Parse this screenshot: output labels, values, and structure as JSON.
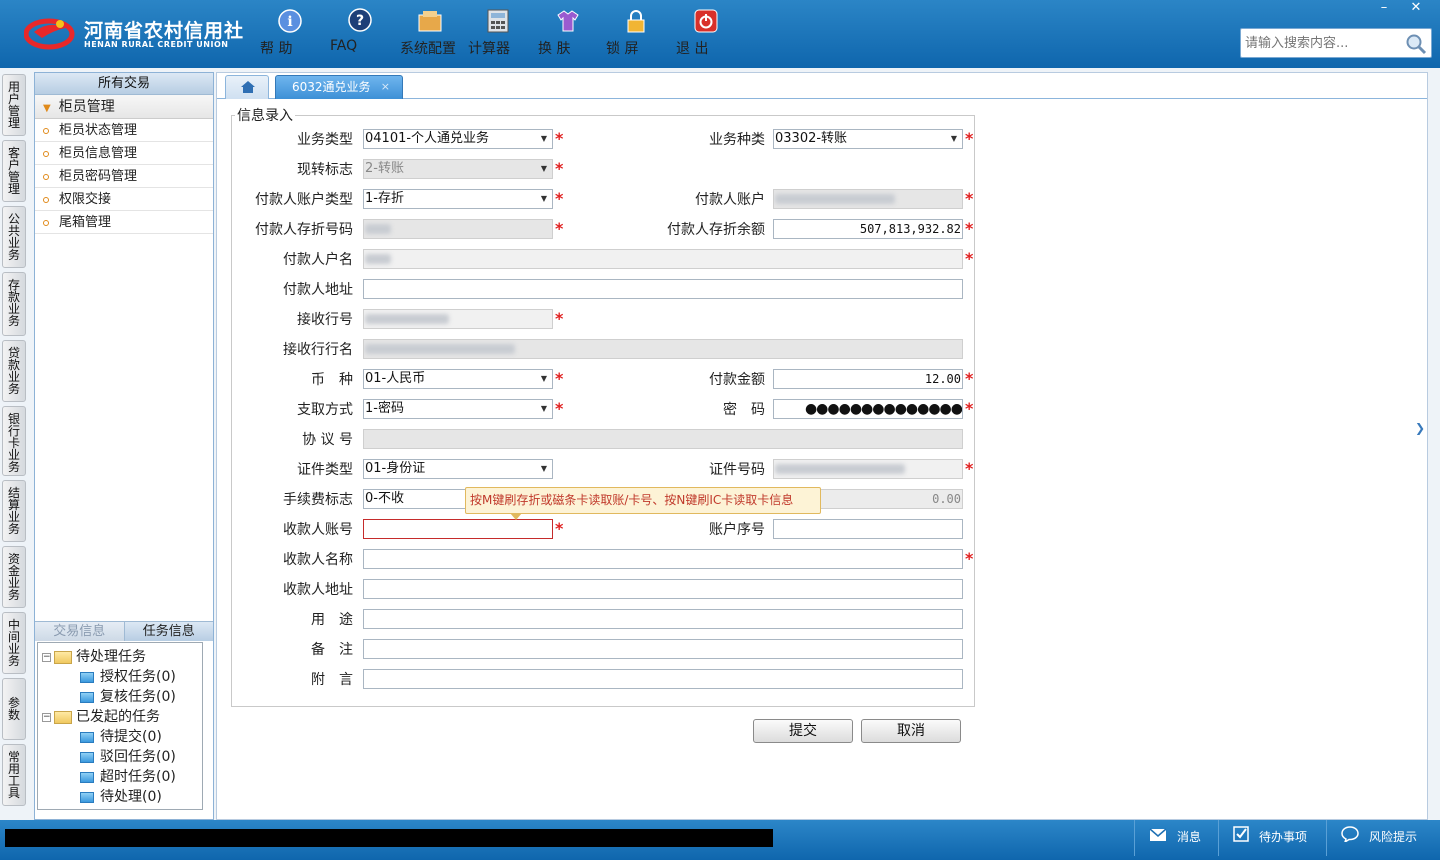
{
  "brand": {
    "cn": "河南省农村信用社",
    "en": "HENAN RURAL CREDIT UNION"
  },
  "toolbar": [
    {
      "label": "帮 助",
      "icon": "help-icon"
    },
    {
      "label": "FAQ",
      "icon": "faq-icon"
    },
    {
      "label": "系统配置",
      "icon": "settings-icon"
    },
    {
      "label": "计算器",
      "icon": "calculator-icon"
    },
    {
      "label": "换 肤",
      "icon": "skin-icon"
    },
    {
      "label": "锁 屏",
      "icon": "lock-icon"
    },
    {
      "label": "退 出",
      "icon": "power-icon"
    }
  ],
  "window": {
    "minimize": "–",
    "close": "✕"
  },
  "search": {
    "placeholder": "请输入搜索内容..."
  },
  "vtabs": [
    "用户管理",
    "客户管理",
    "公共业务",
    "存款业务",
    "贷款业务",
    "银行卡业务",
    "结算业务",
    "资金业务",
    "中间业务",
    "参数",
    "常用工具"
  ],
  "sidebar": {
    "header": "所有交易",
    "group": "柜员管理",
    "items": [
      "柜员状态管理",
      "柜员信息管理",
      "柜员密码管理",
      "权限交接",
      "尾箱管理"
    ]
  },
  "tasks": {
    "tabs": [
      "交易信息",
      "任务信息"
    ],
    "pending": {
      "label": "待处理任务",
      "children": [
        "授权任务(0)",
        "复核任务(0)"
      ]
    },
    "initiated": {
      "label": "已发起的任务",
      "children": [
        "待提交(0)",
        "驳回任务(0)",
        "超时任务(0)",
        "待处理(0)"
      ]
    }
  },
  "tab": {
    "title": "6032通兑业务",
    "close": "×"
  },
  "form": {
    "legend": "信息录入",
    "labels": {
      "biz_type": "业务类型",
      "biz_kind": "业务种类",
      "cash_flag": "现转标志",
      "payer_acct_type": "付款人账户类型",
      "payer_acct": "付款人账户",
      "payer_book_no": "付款人存折号码",
      "payer_balance": "付款人存折余额",
      "payer_name": "付款人户名",
      "payer_addr": "付款人地址",
      "recv_bank_no": "接收行号",
      "recv_bank_name": "接收行行名",
      "currency": "币　种",
      "amount": "付款金额",
      "withdraw": "支取方式",
      "password": "密　码",
      "agreement": "协 议 号",
      "id_type": "证件类型",
      "id_no": "证件号码",
      "fee_flag": "手续费标志",
      "payee_acct": "收款人账号",
      "acct_seq": "账户序号",
      "payee_name": "收款人名称",
      "payee_addr": "收款人地址",
      "purpose": "用　途",
      "remark": "备　注",
      "postscript": "附　言"
    },
    "values": {
      "biz_type": "04101-个人通兑业务",
      "biz_kind": "03302-转账",
      "cash_flag": "2-转账",
      "payer_acct_type": "1-存折",
      "payer_balance": "507,813,932.82",
      "currency": "01-人民币",
      "amount": "12.00",
      "withdraw": "1-密码",
      "password": "●●●●●●●●●●●●●●",
      "id_type": "01-身份证",
      "fee_flag": "0-不收",
      "fee_amount": "0.00"
    },
    "required": "*",
    "tooltip": "按M键刷存折或磁条卡读取账/卡号、按N键刷IC卡读取卡信息"
  },
  "buttons": {
    "submit": "提交",
    "cancel": "取消"
  },
  "status": {
    "messages": "消息",
    "todo": "待办事项",
    "risk": "风险提示"
  }
}
